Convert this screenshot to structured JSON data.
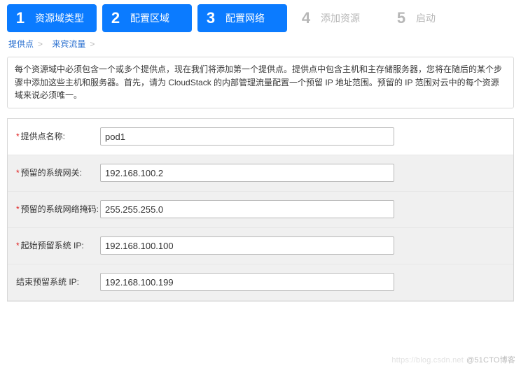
{
  "steps": [
    {
      "num": "1",
      "label": "资源域类型",
      "active": true
    },
    {
      "num": "2",
      "label": "配置区域",
      "active": true
    },
    {
      "num": "3",
      "label": "配置网络",
      "active": true
    },
    {
      "num": "4",
      "label": "添加资源",
      "active": false
    },
    {
      "num": "5",
      "label": "启动",
      "active": false
    }
  ],
  "breadcrumb": {
    "item1": "提供点",
    "item2": "来宾流量",
    "sep": ">"
  },
  "description": "每个资源域中必须包含一个或多个提供点，现在我们将添加第一个提供点。提供点中包含主机和主存储服务器，您将在随后的某个步骤中添加这些主机和服务器。首先，请为 CloudStack 的内部管理流量配置一个预留 IP 地址范围。预留的 IP 范围对云中的每个资源域来说必须唯一。",
  "form": {
    "rows": [
      {
        "required": true,
        "label": "提供点名称:",
        "value": "pod1"
      },
      {
        "required": true,
        "label": "预留的系统网关:",
        "value": "192.168.100.2"
      },
      {
        "required": true,
        "label": "预留的系统网络掩码:",
        "value": "255.255.255.0"
      },
      {
        "required": true,
        "label": "起始预留系统 IP:",
        "value": "192.168.100.100"
      },
      {
        "required": false,
        "label": "结束预留系统 IP:",
        "value": "192.168.100.199"
      }
    ]
  },
  "watermark": {
    "faint": "https://blog.csdn.net",
    "main": "@51CTO博客"
  }
}
